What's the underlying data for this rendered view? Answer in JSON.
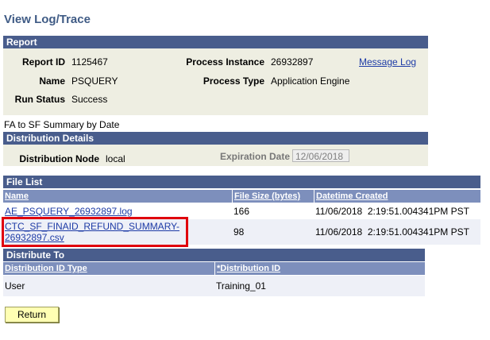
{
  "page": {
    "title": "View Log/Trace"
  },
  "report": {
    "header": "Report",
    "report_id_label": "Report ID",
    "report_id": "1125467",
    "process_instance_label": "Process Instance",
    "process_instance": "26932897",
    "message_log": "Message Log",
    "name_label": "Name",
    "name": "PSQUERY",
    "process_type_label": "Process Type",
    "process_type": "Application Engine",
    "run_status_label": "Run Status",
    "run_status": "Success",
    "description": "FA to SF Summary by Date"
  },
  "distribution_details": {
    "header": "Distribution Details",
    "node_label": "Distribution Node",
    "node": "local",
    "expiration_label": "Expiration Date",
    "expiration": "12/06/2018"
  },
  "file_list": {
    "header": "File List",
    "columns": [
      "Name",
      "File Size (bytes)",
      "Datetime Created"
    ],
    "rows": [
      {
        "name": "AE_PSQUERY_26932897.log",
        "size": "166",
        "created": "11/06/2018  2:19:51.004341PM PST"
      },
      {
        "name_line1": "CTC_SF_FINAID_REFUND_SUMMARY-",
        "name_line2": "26932897.csv",
        "size": "98",
        "created": "11/06/2018  2:19:51.004341PM PST"
      }
    ]
  },
  "distribute_to": {
    "header": "Distribute To",
    "columns": [
      "Distribution ID Type",
      "*Distribution ID"
    ],
    "rows": [
      {
        "type": "User",
        "id": "Training_01"
      }
    ]
  },
  "buttons": {
    "return": "Return"
  },
  "colors": {
    "header_bar": "#495d8c",
    "column_header": "#7d8fbc",
    "panel_bg": "#eeeee2",
    "highlight": "#e0000c",
    "button_bg": "#ffffb3"
  }
}
